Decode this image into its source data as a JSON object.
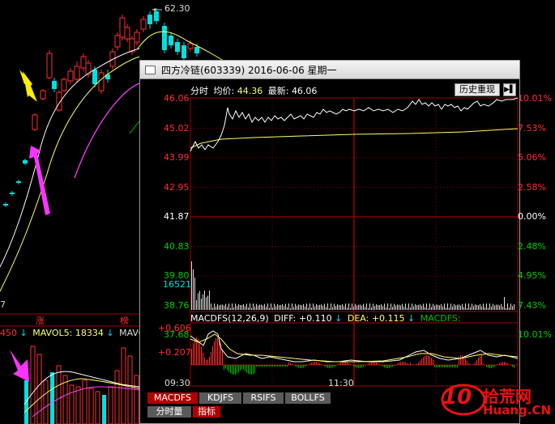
{
  "background": {
    "peak_label": "62.30",
    "limit_up_label": "涨",
    "stop_label": "榜",
    "volume_left_value": "450",
    "mavol5_label": "MAVOL5:",
    "mavol5_value": "18334",
    "mavol_label": "MAVO",
    "bar_label": "7",
    "arrow_symbol": "↓"
  },
  "popup": {
    "title": "四方冷链(603339) 2016-06-06 星期一",
    "header": {
      "mode_label": "分时",
      "avg_label": "均价:",
      "avg_value": "44.36",
      "last_label": "最新:",
      "last_value": "46.06",
      "history_button": "历史重现",
      "nav_icon": "▶▌"
    },
    "price_ticks_left": [
      "46.06",
      "45.02",
      "43.99",
      "42.95",
      "41.87",
      "40.83",
      "39.80",
      "38.76",
      "37.68"
    ],
    "pct_ticks_right": [
      "10.01%",
      "7.53%",
      "5.06%",
      "2.58%",
      "0.00%",
      "2.48%",
      "4.95%",
      "7.43%",
      "10.01%"
    ],
    "volume_value": "16521",
    "macd": {
      "label": "MACDFS(12,26,9)",
      "diff_label": "DIFF:",
      "diff_value": "+0.110",
      "dea_label": "DEA:",
      "dea_value": "+0.115",
      "macdfs_label": "MACDFS:",
      "arrow": "↓",
      "ticks": [
        "+0.606",
        "+0.207"
      ]
    },
    "time_ticks": [
      "09:30",
      "11:30"
    ],
    "indicator_tabs": [
      "MACDFS",
      "KDJFS",
      "RSIFS",
      "BOLLFS"
    ],
    "bottom_tabs": [
      "分时量",
      "指标"
    ]
  },
  "watermark": {
    "logo_number": "10",
    "site_cn": "拾荒网",
    "site_en": "Huang.CN"
  },
  "colors": {
    "up": "#ff3030",
    "down": "#00e0e0",
    "price_line": "#ffffff",
    "avg_line": "#ffff66",
    "ma_magenta": "#ff44ff",
    "grid_red": "#a00000",
    "macd_green": "#00c000"
  }
}
